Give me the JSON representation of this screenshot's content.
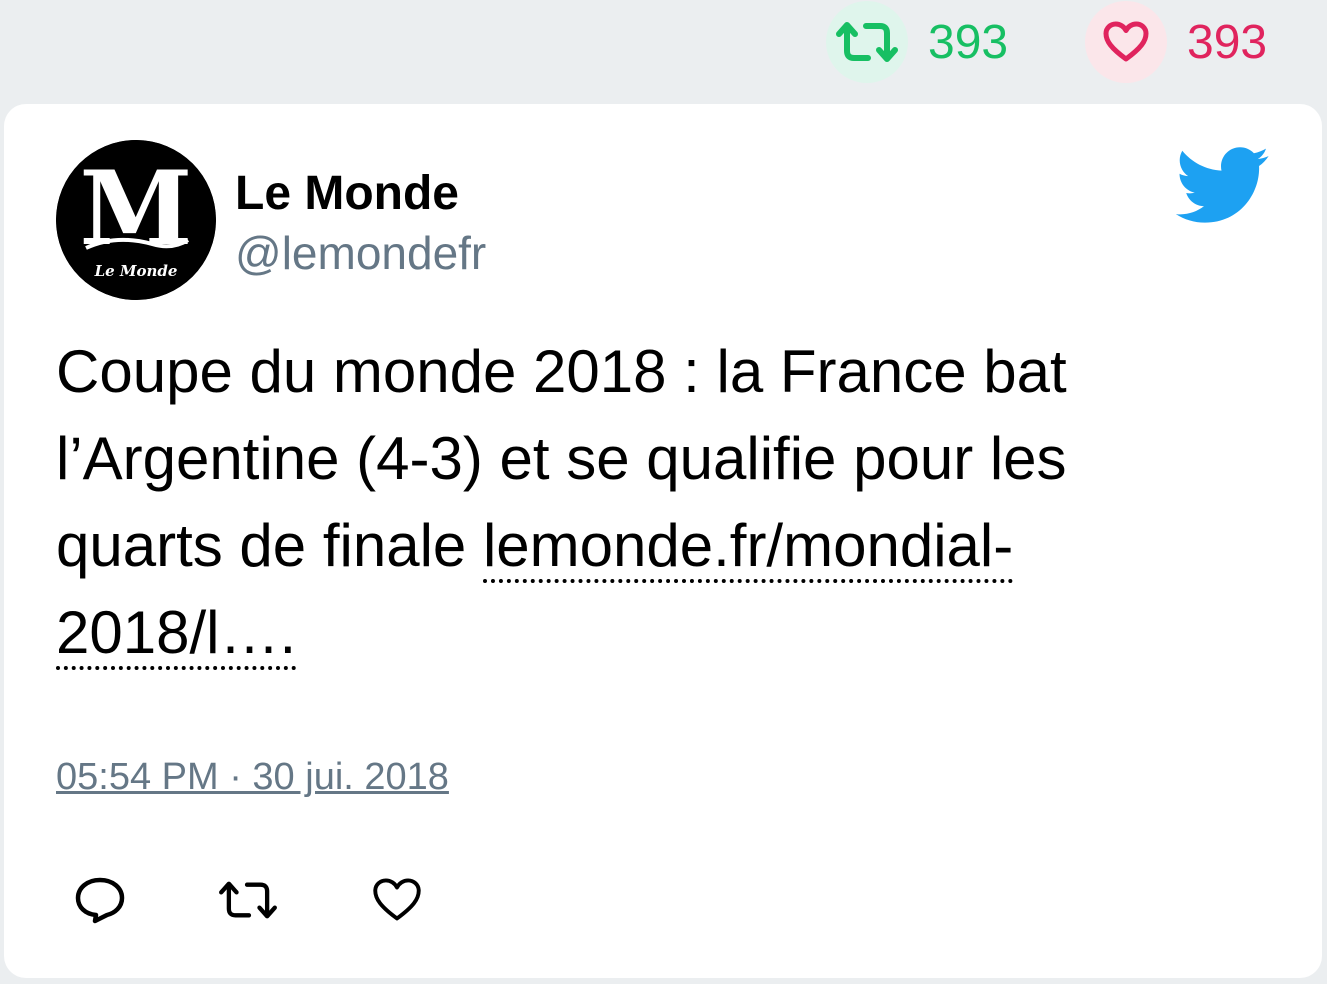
{
  "stats": {
    "retweet_icon": "retweet-icon",
    "retweet_count": "393",
    "like_icon": "heart-icon",
    "like_count": "393",
    "retweet_color": "#17bf63",
    "like_color": "#e0245e"
  },
  "tweet": {
    "author": {
      "display_name": "Le Monde",
      "handle": "@lemondefr",
      "avatar_icon": "le-monde-logo"
    },
    "brand_icon": "twitter-bird-icon",
    "brand_color": "#1da1f2",
    "text": "Coupe du monde 2018 : la France bat l’Argentine (4-3) et se qualifie pour les quarts de finale ",
    "link_text": "lemonde.fr/mondial-2018/l….",
    "timestamp": "05:54 PM · 30 jui. 2018",
    "actions": [
      {
        "name": "reply",
        "icon": "reply-icon"
      },
      {
        "name": "retweet",
        "icon": "retweet-icon"
      },
      {
        "name": "like",
        "icon": "heart-icon"
      }
    ]
  }
}
